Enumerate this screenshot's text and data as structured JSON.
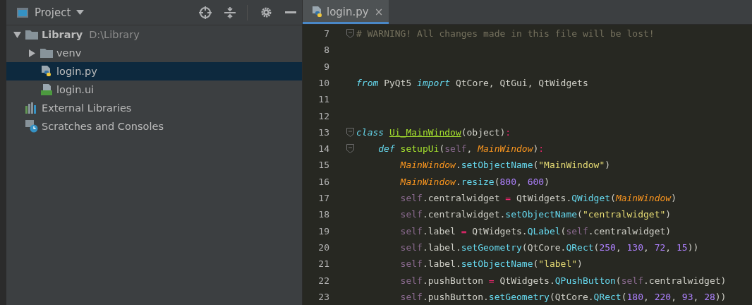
{
  "project_panel": {
    "title": "Project"
  },
  "tree": [
    {
      "kind": "project",
      "label": "Library",
      "path": "D:\\Library",
      "expanded": true,
      "selected": false,
      "children": [
        {
          "kind": "folder",
          "label": "venv",
          "expanded": false,
          "selected": false
        },
        {
          "kind": "python-file",
          "label": "login.py",
          "selected": true
        },
        {
          "kind": "ui-file",
          "label": "login.ui",
          "selected": false
        }
      ]
    },
    {
      "kind": "libraries",
      "label": "External Libraries",
      "selected": false
    },
    {
      "kind": "scratches",
      "label": "Scratches and Consoles",
      "selected": false
    }
  ],
  "editor_tabs": [
    {
      "label": "login.py",
      "selected": true,
      "close": "×"
    }
  ],
  "code_lines": [
    {
      "number": "7",
      "fold": true,
      "tokens": [
        {
          "kind": "comment",
          "text": "# WARNING! All changes made in this file will be lost!"
        }
      ]
    },
    {
      "number": "8",
      "fold": false
    },
    {
      "number": "9",
      "fold": false
    },
    {
      "number": "10",
      "fold": false,
      "tokens": [
        {
          "kind": "kw",
          "text": "from"
        },
        {
          "kind": "plain",
          "text": " PyQt5 "
        },
        {
          "kind": "kw",
          "text": "import"
        },
        {
          "kind": "plain",
          "text": " QtCore, QtGui, QtWidgets"
        }
      ]
    },
    {
      "number": "11",
      "fold": false
    },
    {
      "number": "12",
      "fold": false
    },
    {
      "number": "13",
      "fold": true,
      "tokens": [
        {
          "kind": "kw",
          "text": "class "
        },
        {
          "kind": "cls",
          "text": "Ui_MainWindow"
        },
        {
          "kind": "plain",
          "text": "(object)"
        },
        {
          "kind": "op",
          "text": ":"
        }
      ],
      "children": [
        {
          "number": "14",
          "fold": true,
          "tokens": [
            {
              "kind": "kw",
              "text": "def "
            },
            {
              "kind": "defname",
              "text": "setupUi"
            },
            {
              "kind": "plain",
              "text": "("
            },
            {
              "kind": "self",
              "text": "self"
            },
            {
              "kind": "plain",
              "text": ", "
            },
            {
              "kind": "param",
              "text": "MainWindow"
            },
            {
              "kind": "plain",
              "text": ")"
            },
            {
              "kind": "op",
              "text": ":"
            }
          ],
          "children": [
            {
              "number": "15",
              "fold": false,
              "tokens": [
                {
                  "kind": "param",
                  "text": "MainWindow"
                },
                {
                  "kind": "plain",
                  "text": "."
                },
                {
                  "kind": "fn",
                  "text": "setObjectName"
                },
                {
                  "kind": "plain",
                  "text": "("
                },
                {
                  "kind": "str",
                  "text": "\"MainWindow\""
                },
                {
                  "kind": "plain",
                  "text": ")"
                }
              ]
            },
            {
              "number": "16",
              "fold": false,
              "tokens": [
                {
                  "kind": "param",
                  "text": "MainWindow"
                },
                {
                  "kind": "plain",
                  "text": "."
                },
                {
                  "kind": "fn",
                  "text": "resize"
                },
                {
                  "kind": "plain",
                  "text": "("
                },
                {
                  "kind": "num",
                  "text": "800"
                },
                {
                  "kind": "plain",
                  "text": ", "
                },
                {
                  "kind": "num",
                  "text": "600"
                },
                {
                  "kind": "plain",
                  "text": ")"
                }
              ]
            },
            {
              "number": "17",
              "fold": false,
              "tokens": [
                {
                  "kind": "self",
                  "text": "self"
                },
                {
                  "kind": "plain",
                  "text": ".centralwidget "
                },
                {
                  "kind": "op",
                  "text": "="
                },
                {
                  "kind": "plain",
                  "text": " QtWidgets."
                },
                {
                  "kind": "fn",
                  "text": "QWidget"
                },
                {
                  "kind": "plain",
                  "text": "("
                },
                {
                  "kind": "param",
                  "text": "MainWindow"
                },
                {
                  "kind": "plain",
                  "text": ")"
                }
              ]
            },
            {
              "number": "18",
              "fold": false,
              "tokens": [
                {
                  "kind": "self",
                  "text": "self"
                },
                {
                  "kind": "plain",
                  "text": ".centralwidget."
                },
                {
                  "kind": "fn",
                  "text": "setObjectName"
                },
                {
                  "kind": "plain",
                  "text": "("
                },
                {
                  "kind": "str",
                  "text": "\"centralwidget\""
                },
                {
                  "kind": "plain",
                  "text": ")"
                }
              ]
            },
            {
              "number": "19",
              "fold": false,
              "tokens": [
                {
                  "kind": "self",
                  "text": "self"
                },
                {
                  "kind": "plain",
                  "text": ".label "
                },
                {
                  "kind": "op",
                  "text": "="
                },
                {
                  "kind": "plain",
                  "text": " QtWidgets."
                },
                {
                  "kind": "fn",
                  "text": "QLabel"
                },
                {
                  "kind": "plain",
                  "text": "("
                },
                {
                  "kind": "self",
                  "text": "self"
                },
                {
                  "kind": "plain",
                  "text": ".centralwidget)"
                }
              ]
            },
            {
              "number": "20",
              "fold": false,
              "tokens": [
                {
                  "kind": "self",
                  "text": "self"
                },
                {
                  "kind": "plain",
                  "text": ".label."
                },
                {
                  "kind": "fn",
                  "text": "setGeometry"
                },
                {
                  "kind": "plain",
                  "text": "(QtCore."
                },
                {
                  "kind": "fn",
                  "text": "QRect"
                },
                {
                  "kind": "plain",
                  "text": "("
                },
                {
                  "kind": "num",
                  "text": "250"
                },
                {
                  "kind": "plain",
                  "text": ", "
                },
                {
                  "kind": "num",
                  "text": "130"
                },
                {
                  "kind": "plain",
                  "text": ", "
                },
                {
                  "kind": "num",
                  "text": "72"
                },
                {
                  "kind": "plain",
                  "text": ", "
                },
                {
                  "kind": "num",
                  "text": "15"
                },
                {
                  "kind": "plain",
                  "text": "))"
                }
              ]
            },
            {
              "number": "21",
              "fold": false,
              "tokens": [
                {
                  "kind": "self",
                  "text": "self"
                },
                {
                  "kind": "plain",
                  "text": ".label."
                },
                {
                  "kind": "fn",
                  "text": "setObjectName"
                },
                {
                  "kind": "plain",
                  "text": "("
                },
                {
                  "kind": "str",
                  "text": "\"label\""
                },
                {
                  "kind": "plain",
                  "text": ")"
                }
              ]
            },
            {
              "number": "22",
              "fold": false,
              "tokens": [
                {
                  "kind": "self",
                  "text": "self"
                },
                {
                  "kind": "plain",
                  "text": ".pushButton "
                },
                {
                  "kind": "op",
                  "text": "="
                },
                {
                  "kind": "plain",
                  "text": " QtWidgets."
                },
                {
                  "kind": "fn",
                  "text": "QPushButton"
                },
                {
                  "kind": "plain",
                  "text": "("
                },
                {
                  "kind": "self",
                  "text": "self"
                },
                {
                  "kind": "plain",
                  "text": ".centralwidget)"
                }
              ]
            },
            {
              "number": "23",
              "fold": false,
              "tokens": [
                {
                  "kind": "self",
                  "text": "self"
                },
                {
                  "kind": "plain",
                  "text": ".pushButton."
                },
                {
                  "kind": "fn",
                  "text": "setGeometry"
                },
                {
                  "kind": "plain",
                  "text": "(QtCore."
                },
                {
                  "kind": "fn",
                  "text": "QRect"
                },
                {
                  "kind": "plain",
                  "text": "("
                },
                {
                  "kind": "num",
                  "text": "180"
                },
                {
                  "kind": "plain",
                  "text": ", "
                },
                {
                  "kind": "num",
                  "text": "220"
                },
                {
                  "kind": "plain",
                  "text": ", "
                },
                {
                  "kind": "num",
                  "text": "93"
                },
                {
                  "kind": "plain",
                  "text": ", "
                },
                {
                  "kind": "num",
                  "text": "28"
                },
                {
                  "kind": "plain",
                  "text": "))"
                }
              ]
            }
          ]
        }
      ]
    }
  ]
}
